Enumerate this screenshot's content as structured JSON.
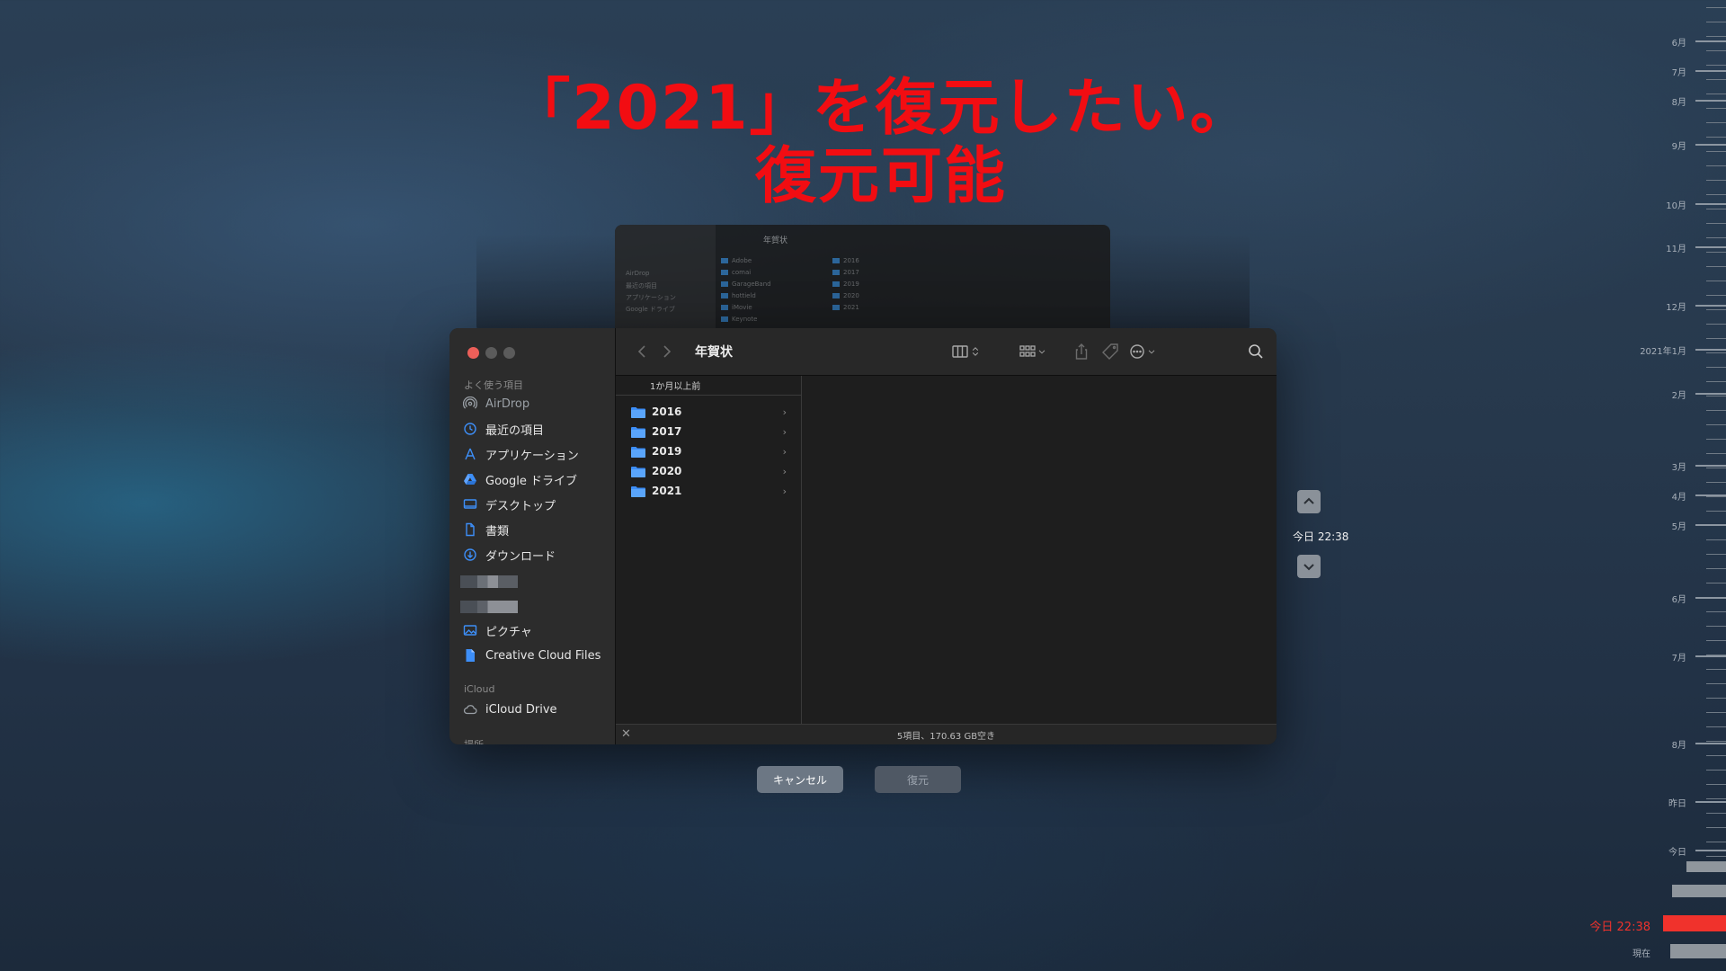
{
  "annotation": {
    "line1": "「2021」を復元したい。",
    "line2": "復元可能"
  },
  "background_window": {
    "title": "年賀状",
    "sidebar": [
      "AirDrop",
      "最近の項目",
      "アプリケーション",
      "Google ドライブ"
    ],
    "col1": [
      "Adobe",
      "comai",
      "GarageBand",
      "hottield",
      "iMovie",
      "Keynote"
    ],
    "col2": [
      "2016",
      "2017",
      "2019",
      "2020",
      "2021"
    ]
  },
  "finder": {
    "window_title": "年賀状",
    "sidebar": {
      "favorites_header": "よく使う項目",
      "favorites": [
        {
          "label": "AirDrop",
          "icon": "airdrop-icon"
        },
        {
          "label": "最近の項目",
          "icon": "clock-icon"
        },
        {
          "label": "アプリケーション",
          "icon": "applications-icon"
        },
        {
          "label": "Google ドライブ",
          "icon": "google-drive-icon"
        },
        {
          "label": "デスクトップ",
          "icon": "desktop-icon"
        },
        {
          "label": "書類",
          "icon": "document-icon"
        },
        {
          "label": "ダウンロード",
          "icon": "download-icon"
        },
        {
          "label": "ピクチャ",
          "icon": "pictures-icon"
        },
        {
          "label": "Creative Cloud Files",
          "icon": "file-icon"
        }
      ],
      "icloud_header": "iCloud",
      "icloud": [
        {
          "label": "iCloud Drive",
          "icon": "cloud-icon"
        }
      ],
      "locations_header": "場所"
    },
    "column": {
      "header": "1か月以上前",
      "items": [
        "2016",
        "2017",
        "2019",
        "2020",
        "2021"
      ]
    },
    "status": "5項目、170.63 GB空き"
  },
  "buttons": {
    "cancel": "キャンセル",
    "restore": "復元"
  },
  "time_machine": {
    "current_time": "今日 22:38",
    "timeline_labels": [
      "6月",
      "7月",
      "8月",
      "9月",
      "10月",
      "11月",
      "12月",
      "2021年1月",
      "2月",
      "3月",
      "4月",
      "5月",
      "6月",
      "7月",
      "8月",
      "昨日",
      "今日"
    ],
    "now_label": "今日 22:38",
    "present_label": "現在"
  },
  "colors": {
    "annotation": "#f20d12",
    "folder": "#3d8ef7",
    "timeline_now": "#f0322c"
  }
}
